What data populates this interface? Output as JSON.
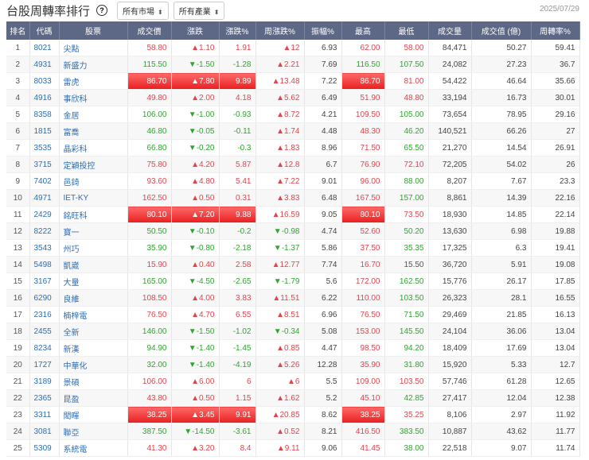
{
  "header": {
    "title": "台股周轉率排行",
    "help_icon": "?",
    "market_select": "所有市場",
    "industry_select": "所有產業",
    "date": "2025/07/29"
  },
  "colors": {
    "up": "#e4434c",
    "down": "#2ea52e",
    "header_bg": "#5d6786",
    "limit_up": "#e81f1f"
  },
  "columns": [
    "排名",
    "代碼",
    "股票",
    "成交價",
    "漲跌",
    "漲跌%",
    "周漲跌%",
    "振幅%",
    "最高",
    "最低",
    "成交量",
    "成交值 (億)",
    "周轉率%"
  ],
  "rows": [
    [
      "1",
      "8021",
      "尖點",
      "58.80",
      "▲1.10",
      "1.91",
      "▲12",
      "6.93",
      "62.00",
      "58.00",
      "84,471",
      "50.27",
      "59.41",
      "rrrrrr"
    ],
    [
      "2",
      "4931",
      "新盛力",
      "115.50",
      "▼-1.50",
      "-1.28",
      "▲2.21",
      "7.69",
      "116.50",
      "107.50",
      "24,082",
      "27.23",
      "36.7",
      "gggrgg"
    ],
    [
      "3",
      "8033",
      "雷虎",
      "86.70",
      "▲7.80",
      "9.89",
      "▲13.48",
      "7.22",
      "86.70",
      "81.00",
      "54,422",
      "46.64",
      "35.66",
      "LLLrLr"
    ],
    [
      "4",
      "4916",
      "事欣科",
      "49.80",
      "▲2.00",
      "4.18",
      "▲5.62",
      "6.49",
      "51.90",
      "48.80",
      "33,194",
      "16.73",
      "30.01",
      "rrrrrr"
    ],
    [
      "5",
      "8358",
      "金居",
      "106.00",
      "▼-1.00",
      "-0.93",
      "▲8.72",
      "4.21",
      "109.50",
      "105.00",
      "73,654",
      "78.95",
      "29.16",
      "gggrrg"
    ],
    [
      "6",
      "1815",
      "富喬",
      "46.80",
      "▼-0.05",
      "-0.11",
      "▲1.74",
      "4.48",
      "48.30",
      "46.20",
      "140,521",
      "66.26",
      "27",
      "gggrrg"
    ],
    [
      "7",
      "3535",
      "晶彩科",
      "66.80",
      "▼-0.20",
      "-0.3",
      "▲1.83",
      "8.96",
      "71.50",
      "65.50",
      "21,270",
      "14.54",
      "26.91",
      "gggrrg"
    ],
    [
      "8",
      "3715",
      "定穎投控",
      "75.80",
      "▲4.20",
      "5.87",
      "▲12.8",
      "6.7",
      "76.90",
      "72.10",
      "72,205",
      "54.02",
      "26",
      "rrrrrr"
    ],
    [
      "9",
      "7402",
      "邑錡",
      "93.60",
      "▲4.80",
      "5.41",
      "▲7.22",
      "9.01",
      "96.00",
      "88.00",
      "8,207",
      "7.67",
      "23.3",
      "rrrrrg"
    ],
    [
      "10",
      "4971",
      "IET-KY",
      "162.50",
      "▲0.50",
      "0.31",
      "▲3.83",
      "6.48",
      "167.50",
      "157.00",
      "8,861",
      "14.39",
      "22.16",
      "rrrrrg"
    ],
    [
      "11",
      "2429",
      "銘旺科",
      "80.10",
      "▲7.20",
      "9.88",
      "▲16.59",
      "9.05",
      "80.10",
      "73.50",
      "18,930",
      "14.85",
      "22.14",
      "LLLrLr"
    ],
    [
      "12",
      "8222",
      "寶一",
      "50.50",
      "▼-0.10",
      "-0.2",
      "▼-0.98",
      "4.74",
      "52.60",
      "50.20",
      "13,630",
      "6.98",
      "19.88",
      "ggggrg"
    ],
    [
      "13",
      "3543",
      "州巧",
      "35.90",
      "▼-0.80",
      "-2.18",
      "▼-1.37",
      "5.86",
      "37.50",
      "35.35",
      "17,325",
      "6.3",
      "19.41",
      "ggggrg"
    ],
    [
      "14",
      "5498",
      "凱崴",
      "15.90",
      "▲0.40",
      "2.58",
      "▲12.77",
      "7.74",
      "16.70",
      "15.50",
      "36,720",
      "5.91",
      "19.08",
      "rrrrrn"
    ],
    [
      "15",
      "3167",
      "大量",
      "165.00",
      "▼-4.50",
      "-2.65",
      "▼-1.79",
      "5.6",
      "172.00",
      "162.50",
      "15,776",
      "26.17",
      "17.85",
      "ggggrg"
    ],
    [
      "16",
      "6290",
      "良維",
      "108.50",
      "▲4.00",
      "3.83",
      "▲11.51",
      "6.22",
      "110.00",
      "103.50",
      "26,323",
      "28.1",
      "16.55",
      "rrrrrg"
    ],
    [
      "17",
      "2316",
      "楠梓電",
      "76.50",
      "▲4.70",
      "6.55",
      "▲8.51",
      "6.96",
      "76.50",
      "71.50",
      "29,469",
      "21.85",
      "16.13",
      "rrrrrg"
    ],
    [
      "18",
      "2455",
      "全新",
      "146.00",
      "▼-1.50",
      "-1.02",
      "▼-0.34",
      "5.08",
      "153.00",
      "145.50",
      "24,104",
      "36.06",
      "13.04",
      "ggggrg"
    ],
    [
      "19",
      "8234",
      "新漢",
      "94.90",
      "▼-1.40",
      "-1.45",
      "▲0.85",
      "4.47",
      "98.50",
      "94.20",
      "18,409",
      "17.69",
      "13.04",
      "gggrrg"
    ],
    [
      "20",
      "1727",
      "中華化",
      "32.00",
      "▼-1.40",
      "-4.19",
      "▲5.26",
      "12.28",
      "35.90",
      "31.80",
      "15,920",
      "5.33",
      "12.7",
      "gggrrg"
    ],
    [
      "21",
      "3189",
      "景碩",
      "106.00",
      "▲6.00",
      "6",
      "▲6",
      "5.5",
      "109.00",
      "103.50",
      "57,746",
      "61.28",
      "12.65",
      "rrrrrr"
    ],
    [
      "22",
      "2365",
      "昆盈",
      "43.80",
      "▲0.50",
      "1.15",
      "▲1.62",
      "5.2",
      "45.10",
      "42.85",
      "27,417",
      "12.04",
      "12.38",
      "rrrrrg"
    ],
    [
      "23",
      "3311",
      "閎暉",
      "38.25",
      "▲3.45",
      "9.91",
      "▲20.85",
      "8.62",
      "38.25",
      "35.25",
      "8,106",
      "2.97",
      "11.92",
      "LLLrLr"
    ],
    [
      "24",
      "3081",
      "聯亞",
      "387.50",
      "▼-14.50",
      "-3.61",
      "▲0.52",
      "8.21",
      "416.50",
      "383.50",
      "10,887",
      "43.62",
      "11.77",
      "gggrrg"
    ],
    [
      "25",
      "5309",
      "系統電",
      "41.30",
      "▲3.20",
      "8.4",
      "▲9.11",
      "9.06",
      "41.45",
      "38.00",
      "22,518",
      "9.07",
      "11.74",
      "rrrrrg"
    ]
  ]
}
